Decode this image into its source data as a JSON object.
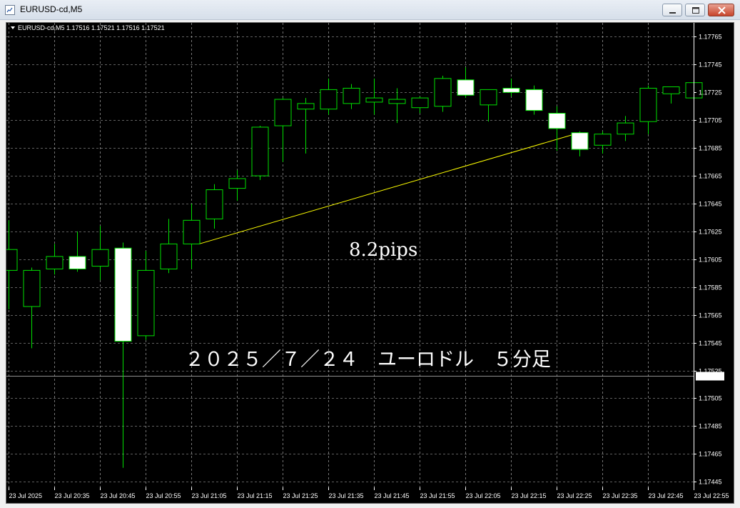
{
  "window": {
    "title": "EURUSD-cd,M5"
  },
  "chart": {
    "info_line": "EURUSD-cd,M5  1.17516 1.17521 1.17516 1.17521",
    "annotation_pips": "8.2pips",
    "annotation_caption": "２０２５／７／２４　ユーロドル　５分足",
    "current_price_label": "1.17521",
    "colors": {
      "background": "#000000",
      "grid": "#c0c0c0",
      "candle_outline": "#00e000",
      "bull_fill": "#000000",
      "bear_fill": "#ffffff",
      "trendline": "#ffff00",
      "bid_line": "#c0c0c0"
    }
  },
  "chart_data": {
    "type": "candlestick",
    "symbol": "EURUSD-cd",
    "timeframe": "M5",
    "y_ticks": [
      "1.17765",
      "1.17745",
      "1.17725",
      "1.17705",
      "1.17685",
      "1.17665",
      "1.17645",
      "1.17625",
      "1.17605",
      "1.17585",
      "1.17565",
      "1.17545",
      "1.17525",
      "1.17505",
      "1.17485",
      "1.17465",
      "1.17445"
    ],
    "x_ticks": [
      "23 Jul 2025",
      "23 Jul 20:35",
      "23 Jul 20:45",
      "23 Jul 20:55",
      "23 Jul 21:05",
      "23 Jul 21:15",
      "23 Jul 21:25",
      "23 Jul 21:35",
      "23 Jul 21:45",
      "23 Jul 21:55",
      "23 Jul 22:05",
      "23 Jul 22:15",
      "23 Jul 22:25",
      "23 Jul 22:35",
      "23 Jul 22:45",
      "23 Jul 22:55"
    ],
    "ylim": [
      1.17441,
      1.17775
    ],
    "current_price": 1.17521,
    "candles": [
      {
        "o": 1.17597,
        "h": 1.17633,
        "l": 1.17569,
        "c": 1.17612
      },
      {
        "o": 1.17571,
        "h": 1.17599,
        "l": 1.17541,
        "c": 1.17597
      },
      {
        "o": 1.17598,
        "h": 1.17616,
        "l": 1.17594,
        "c": 1.17607
      },
      {
        "o": 1.17607,
        "h": 1.17625,
        "l": 1.17596,
        "c": 1.17598
      },
      {
        "o": 1.176,
        "h": 1.17629,
        "l": 1.1759,
        "c": 1.17612
      },
      {
        "o": 1.17613,
        "h": 1.17617,
        "l": 1.17455,
        "c": 1.17546
      },
      {
        "o": 1.1755,
        "h": 1.17611,
        "l": 1.17547,
        "c": 1.17597
      },
      {
        "o": 1.17598,
        "h": 1.17634,
        "l": 1.17595,
        "c": 1.17616
      },
      {
        "o": 1.17616,
        "h": 1.17645,
        "l": 1.17598,
        "c": 1.17633
      },
      {
        "o": 1.17634,
        "h": 1.17659,
        "l": 1.17627,
        "c": 1.17655
      },
      {
        "o": 1.17656,
        "h": 1.17669,
        "l": 1.17647,
        "c": 1.17663
      },
      {
        "o": 1.17665,
        "h": 1.17701,
        "l": 1.17662,
        "c": 1.177
      },
      {
        "o": 1.17701,
        "h": 1.17721,
        "l": 1.17675,
        "c": 1.1772
      },
      {
        "o": 1.17713,
        "h": 1.17721,
        "l": 1.17681,
        "c": 1.17717
      },
      {
        "o": 1.17713,
        "h": 1.17735,
        "l": 1.17709,
        "c": 1.17727
      },
      {
        "o": 1.17717,
        "h": 1.17731,
        "l": 1.17713,
        "c": 1.17728
      },
      {
        "o": 1.17718,
        "h": 1.17735,
        "l": 1.17709,
        "c": 1.17721
      },
      {
        "o": 1.17717,
        "h": 1.17728,
        "l": 1.17703,
        "c": 1.1772
      },
      {
        "o": 1.17714,
        "h": 1.17722,
        "l": 1.1771,
        "c": 1.17721
      },
      {
        "o": 1.17715,
        "h": 1.17737,
        "l": 1.17711,
        "c": 1.17735
      },
      {
        "o": 1.17734,
        "h": 1.17743,
        "l": 1.17721,
        "c": 1.17723
      },
      {
        "o": 1.17716,
        "h": 1.17726,
        "l": 1.17704,
        "c": 1.17727
      },
      {
        "o": 1.17728,
        "h": 1.17735,
        "l": 1.17722,
        "c": 1.17725
      },
      {
        "o": 1.17727,
        "h": 1.1773,
        "l": 1.17709,
        "c": 1.17712
      },
      {
        "o": 1.1771,
        "h": 1.17715,
        "l": 1.17683,
        "c": 1.17699
      },
      {
        "o": 1.17696,
        "h": 1.17697,
        "l": 1.17679,
        "c": 1.17684
      },
      {
        "o": 1.17687,
        "h": 1.17697,
        "l": 1.17681,
        "c": 1.17695
      },
      {
        "o": 1.17695,
        "h": 1.17708,
        "l": 1.1769,
        "c": 1.17703
      },
      {
        "o": 1.17704,
        "h": 1.1773,
        "l": 1.17695,
        "c": 1.17728
      },
      {
        "o": 1.17724,
        "h": 1.17729,
        "l": 1.17717,
        "c": 1.17729
      },
      {
        "o": 1.17721,
        "h": 1.17741,
        "l": 1.17721,
        "c": 1.17732
      }
    ],
    "trendline": {
      "from_candle": 8,
      "from_price": 1.17616,
      "to_candle": 25,
      "to_price": 1.17696
    }
  }
}
